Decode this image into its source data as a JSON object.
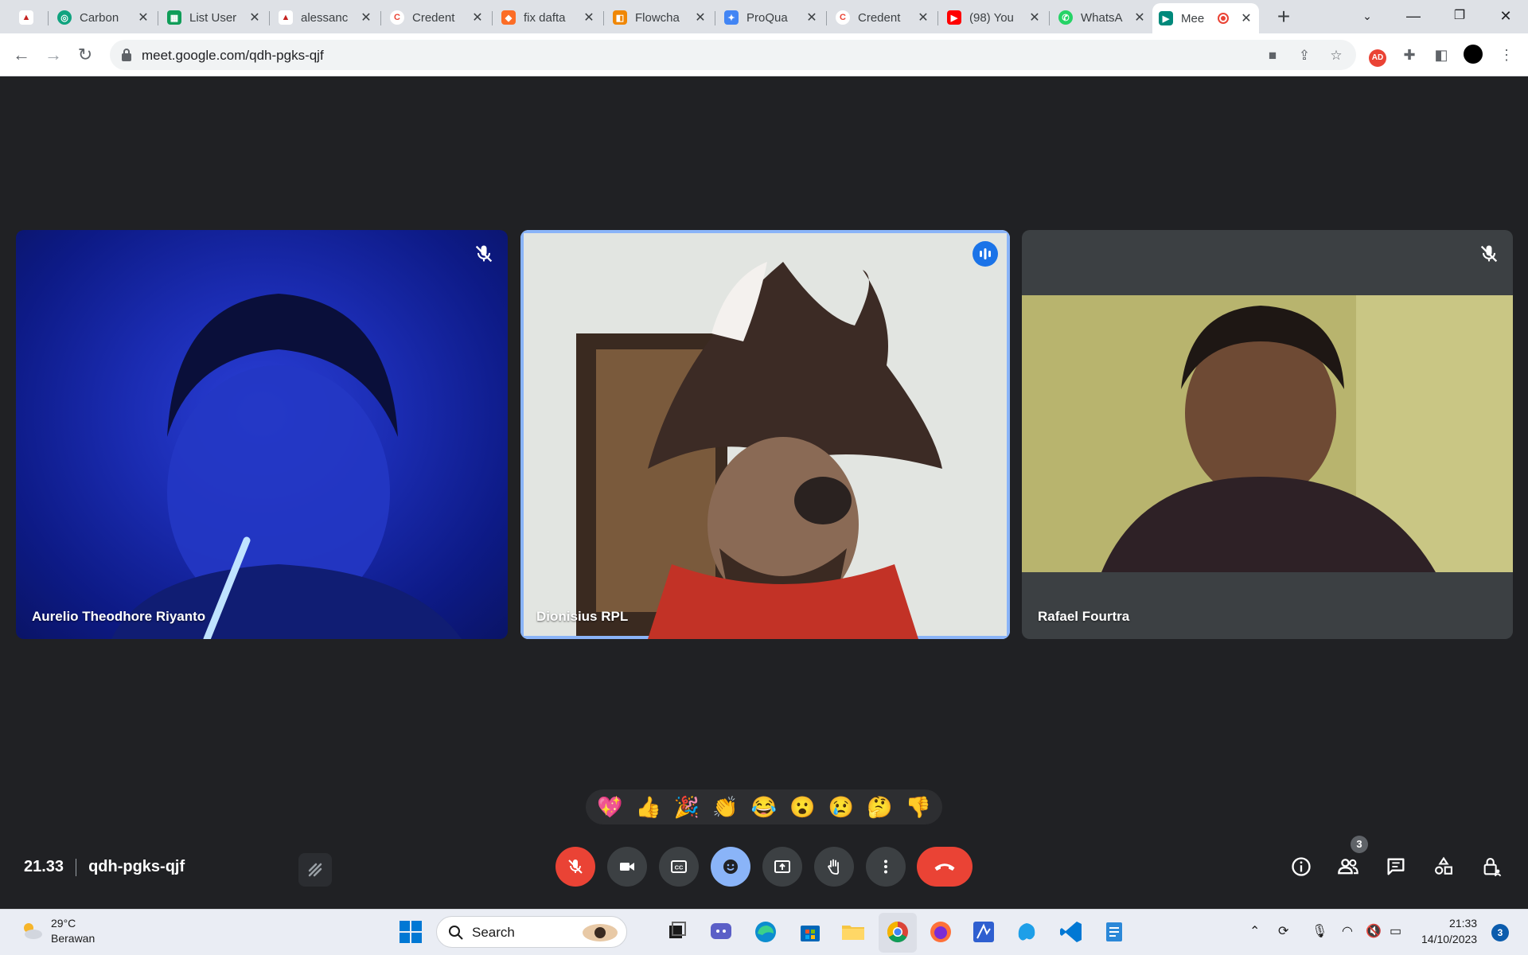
{
  "browser": {
    "tabs": [
      {
        "title": "",
        "icon": "tapak-suci-icon",
        "color": "#c5221f"
      },
      {
        "title": "Carbon",
        "icon": "openai-icon",
        "color": "#10a37f"
      },
      {
        "title": "List User",
        "icon": "google-sheets-icon",
        "color": "#0f9d58"
      },
      {
        "title": "alessanc",
        "icon": "tapak-suci-icon",
        "color": "#c5221f"
      },
      {
        "title": "Credent",
        "icon": "google-cloud-icon",
        "color": "#ea4335"
      },
      {
        "title": "fix dafta",
        "icon": "gitlab-icon",
        "color": "#fc6d26"
      },
      {
        "title": "Flowcha",
        "icon": "drawio-icon",
        "color": "#f08705"
      },
      {
        "title": "ProQua",
        "icon": "proquant-icon",
        "color": "#4285f4"
      },
      {
        "title": "Credent",
        "icon": "google-cloud-icon",
        "color": "#ea4335"
      },
      {
        "title": "(98) You",
        "icon": "youtube-icon",
        "color": "#ff0000"
      },
      {
        "title": "WhatsA",
        "icon": "whatsapp-icon",
        "color": "#25d366"
      },
      {
        "title": "Mee",
        "icon": "google-meet-icon",
        "color": "#00897b"
      }
    ],
    "url": "meet.google.com/qdh-pgks-qjf"
  },
  "meeting": {
    "participants": [
      {
        "name": "Aurelio Theodhore Riyanto",
        "muted": true,
        "speaking": false
      },
      {
        "name": "Dionisius RPL",
        "muted": false,
        "speaking": true
      },
      {
        "name": "Rafael Fourtra",
        "muted": true,
        "speaking": false
      }
    ],
    "reactions": [
      "💖",
      "👍",
      "🎉",
      "👏",
      "😂",
      "😮",
      "😢",
      "🤔",
      "👎"
    ],
    "time": "21.33",
    "code": "qdh-pgks-qjf",
    "people_count": "3"
  },
  "taskbar": {
    "weather_temp": "29°C",
    "weather_desc": "Berawan",
    "search_label": "Search",
    "clock_time": "21:33",
    "clock_date": "14/10/2023",
    "notification_count": "3"
  },
  "colors": {
    "accent": "#8ab4f8",
    "end_call": "#ea4335",
    "meet_bg": "#202124"
  }
}
